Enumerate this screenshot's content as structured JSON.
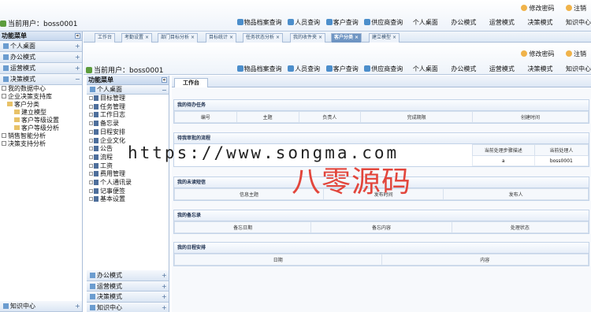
{
  "header": {
    "user_label": "当前用户：",
    "username": "boss0001",
    "change_password": "修改密码",
    "logout": "注销",
    "nav": [
      "物品档案查询",
      "人员查询",
      "客户查询",
      "供应商查询",
      "个人桌面",
      "办公模式",
      "运营模式",
      "决策模式",
      "知识中心"
    ]
  },
  "left_panel": {
    "title": "功能菜单",
    "sections": [
      "个人桌面",
      "办公模式",
      "运营模式",
      "决策模式"
    ],
    "tree": [
      "我的数据中心",
      "企业决策支持库",
      "客户分类",
      "建立模型",
      "客户等级设置",
      "客户等级分析",
      "销售智能分析",
      "决策支持分析"
    ],
    "bottom_section": "知识中心"
  },
  "tabs": [
    "工作台",
    "考勤设置",
    "部门目标分析",
    "目标统计",
    "任务状态分析",
    "我的收件夹",
    "客户分类",
    "建立模型"
  ],
  "inner": {
    "menu_title": "功能菜单",
    "personal_desktop": "个人桌面",
    "items": [
      "目标管理",
      "任务管理",
      "工作日志",
      "备忘录",
      "日程安排",
      "企业文化",
      "公告",
      "流程",
      "工资",
      "费用管理",
      "个人通讯录",
      "记事便签",
      "基本设置"
    ],
    "bottom_sections": [
      "办公模式",
      "运营模式",
      "决策模式",
      "知识中心"
    ]
  },
  "workspace": {
    "tab": "工作台",
    "tasks": {
      "title": "我的待办任务",
      "headers": [
        "编号",
        "主题",
        "负责人",
        "完成期限",
        "创建时间"
      ]
    },
    "approval": {
      "title": "待我审批的流程",
      "headers": [
        "当前处理步骤描述",
        "当前处理人"
      ],
      "row": [
        "a",
        "boss0001"
      ]
    },
    "messages": {
      "title": "我的未读短信",
      "headers": [
        "信息主题",
        "发布时间",
        "发布人"
      ]
    },
    "memo": {
      "title": "我的备忘录",
      "headers": [
        "备忘日期",
        "备忘内容",
        "处理状态"
      ]
    },
    "schedule": {
      "title": "我的日程安排",
      "headers": [
        "日期",
        "内容"
      ]
    }
  },
  "watermark": {
    "url": "https://www.songma.com",
    "cn": "八零源码"
  }
}
